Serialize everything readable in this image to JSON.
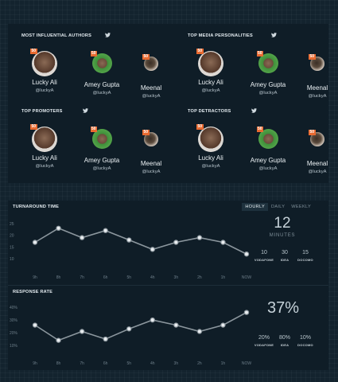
{
  "groups": [
    {
      "title": "MOST INFLUENTIAL AUTHORS",
      "people": [
        {
          "badge": "50",
          "name": "Lucky Ali",
          "handle": "@luckyA"
        },
        {
          "badge": "50",
          "name": "Amey Gupta",
          "handle": "@luckyA"
        },
        {
          "badge": "50",
          "name": "Meenal",
          "handle": "@luckyA"
        }
      ]
    },
    {
      "title": "TOP MEDIA PERSONALITIES",
      "people": [
        {
          "badge": "50",
          "name": "Lucky Ali",
          "handle": "@luckyA"
        },
        {
          "badge": "50",
          "name": "Amey Gupta",
          "handle": "@luckyA"
        },
        {
          "badge": "50",
          "name": "Meenal",
          "handle": "@luckyA"
        }
      ]
    },
    {
      "title": "TOP PROMOTERS",
      "people": [
        {
          "badge": "50",
          "name": "Lucky Ali",
          "handle": "@luckyA"
        },
        {
          "badge": "50",
          "name": "Amey Gupta",
          "handle": "@luckyA"
        },
        {
          "badge": "50",
          "name": "Meenal",
          "handle": "@luckyA"
        }
      ]
    },
    {
      "title": "TOP DETRACTORS",
      "people": [
        {
          "badge": "50",
          "name": "Lucky Ali",
          "handle": "@luckyA"
        },
        {
          "badge": "50",
          "name": "Amey Gupta",
          "handle": "@luckyA"
        },
        {
          "badge": "50",
          "name": "Meenal",
          "handle": "@luckyA"
        }
      ]
    }
  ],
  "turnaround": {
    "title": "TURNAROUND TIME",
    "tabs": [
      "HOURLY",
      "DAILY",
      "WEEKLY"
    ],
    "active_tab": "HOURLY",
    "big_value": "12",
    "big_unit": "MINUTES",
    "breakdown": [
      {
        "value": "10",
        "label": "VODAFONE"
      },
      {
        "value": "30",
        "label": "IDEA"
      },
      {
        "value": "15",
        "label": "DOCOMO"
      }
    ]
  },
  "response": {
    "title": "RESPONSE RATE",
    "big_value": "37%",
    "breakdown": [
      {
        "value": "20%",
        "label": "VODAFONE"
      },
      {
        "value": "80%",
        "label": "IDEA"
      },
      {
        "value": "10%",
        "label": "DOCOMO"
      }
    ]
  },
  "chart_data": [
    {
      "type": "line",
      "categories": [
        "9h",
        "8h",
        "7h",
        "6h",
        "5h",
        "4h",
        "3h",
        "2h",
        "1h",
        "NOW"
      ],
      "y_ticks": [
        "25",
        "20",
        "15",
        "10"
      ],
      "ylim": [
        7,
        27
      ],
      "values": [
        17,
        23,
        19,
        22,
        18,
        14,
        17,
        19,
        17,
        12
      ]
    },
    {
      "type": "line",
      "categories": [
        "9h",
        "8h",
        "7h",
        "6h",
        "5h",
        "4h",
        "3h",
        "2h",
        "1h",
        "NOW"
      ],
      "y_ticks": [
        "40%",
        "30%",
        "20%",
        "10%"
      ],
      "ylim": [
        5,
        42
      ],
      "values": [
        26,
        14,
        21,
        15,
        23,
        30,
        26,
        21,
        26,
        36
      ]
    }
  ],
  "colors": {
    "background": "#13232e",
    "panel": "#0f1d27",
    "badge": "#e96a30",
    "line": "#8b969d",
    "point_fill": "#e9edf0",
    "twitter": "#cfd8de"
  }
}
